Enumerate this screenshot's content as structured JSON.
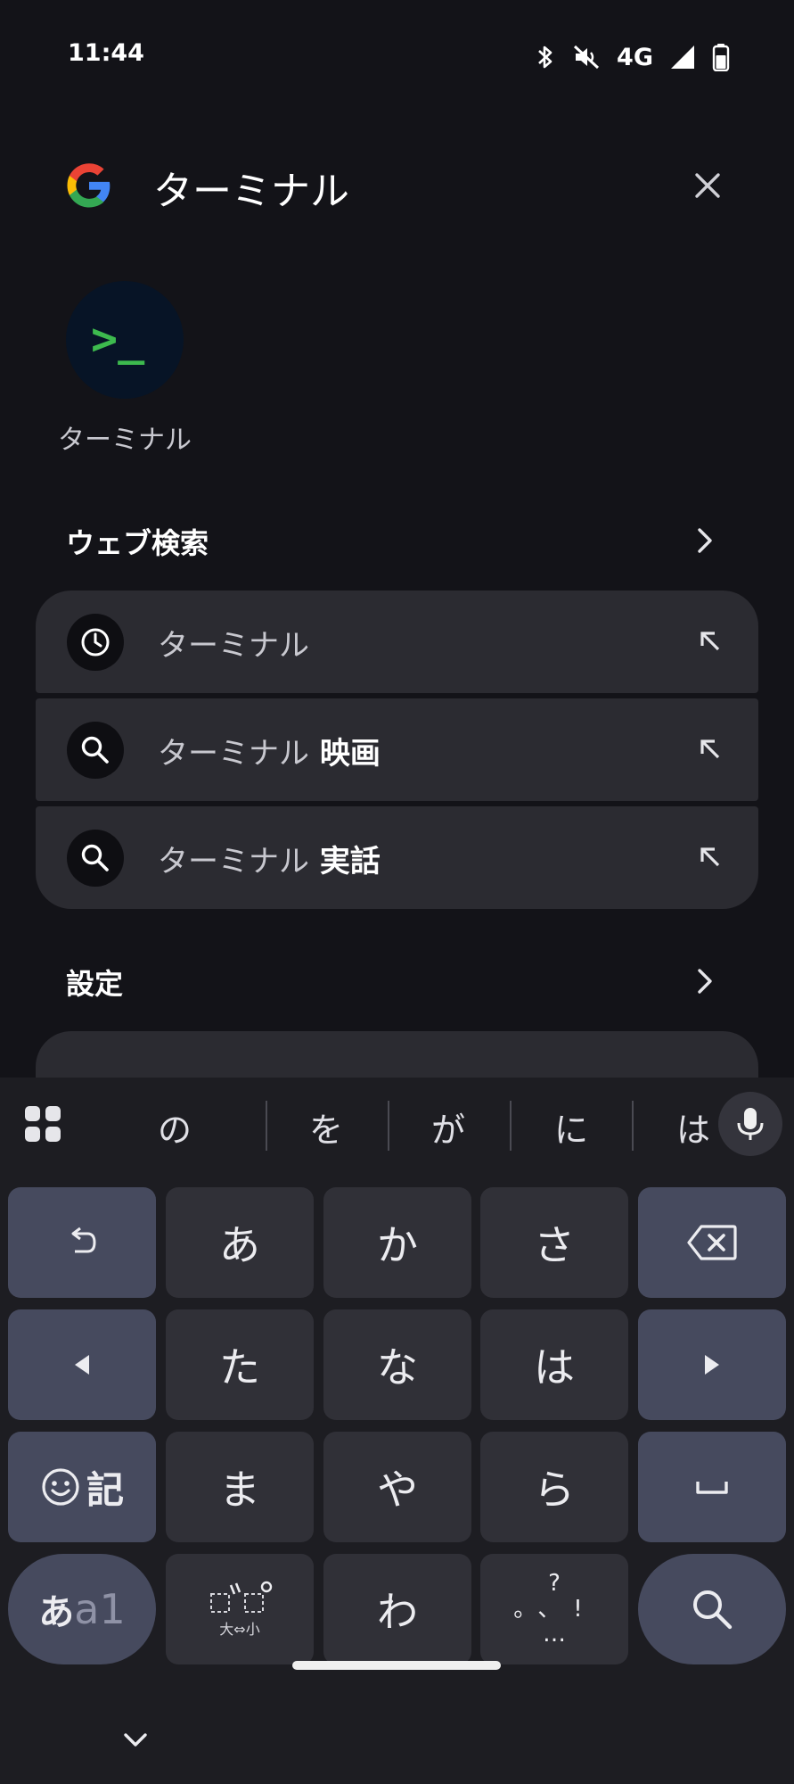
{
  "status_bar": {
    "time": "11:44",
    "network": "4G",
    "icons": [
      "bluetooth-icon",
      "mute-icon",
      "signal-icon",
      "battery-icon"
    ]
  },
  "search": {
    "query": "ターミナル",
    "engine_logo": "google-logo",
    "clear_icon": "close-icon"
  },
  "app_result": {
    "label": "ターミナル",
    "icon_glyph": ">_",
    "icon_color": "#3dba4e"
  },
  "web_search": {
    "title": "ウェブ検索",
    "suggestions": [
      {
        "icon": "history-icon",
        "prefix": "ターミナル",
        "suffix": ""
      },
      {
        "icon": "search-icon",
        "prefix": "ターミナル",
        "suffix": " 映画"
      },
      {
        "icon": "search-icon",
        "prefix": "ターミナル",
        "suffix": " 実話"
      }
    ]
  },
  "settings": {
    "title": "設定"
  },
  "keyboard": {
    "candidates": [
      "の",
      "を",
      "が",
      "に",
      "は"
    ],
    "keys": {
      "a": "あ",
      "ka": "か",
      "sa": "さ",
      "ta": "た",
      "na": "な",
      "ha": "は",
      "ma": "ま",
      "ya": "や",
      "ra": "ら",
      "wa": "わ",
      "emoji_kigou": "記",
      "mode_a": "あ",
      "mode_a1": "a1",
      "dakuten_small": "大⇔小",
      "punct_top": "?",
      "punct_mid": "。、!",
      "punct_bottom": "…"
    }
  },
  "colors": {
    "background": "#131318",
    "card": "#2b2b31",
    "keyboard": "#1d1d22",
    "key": "#303037",
    "func_key": "#464a5e"
  }
}
